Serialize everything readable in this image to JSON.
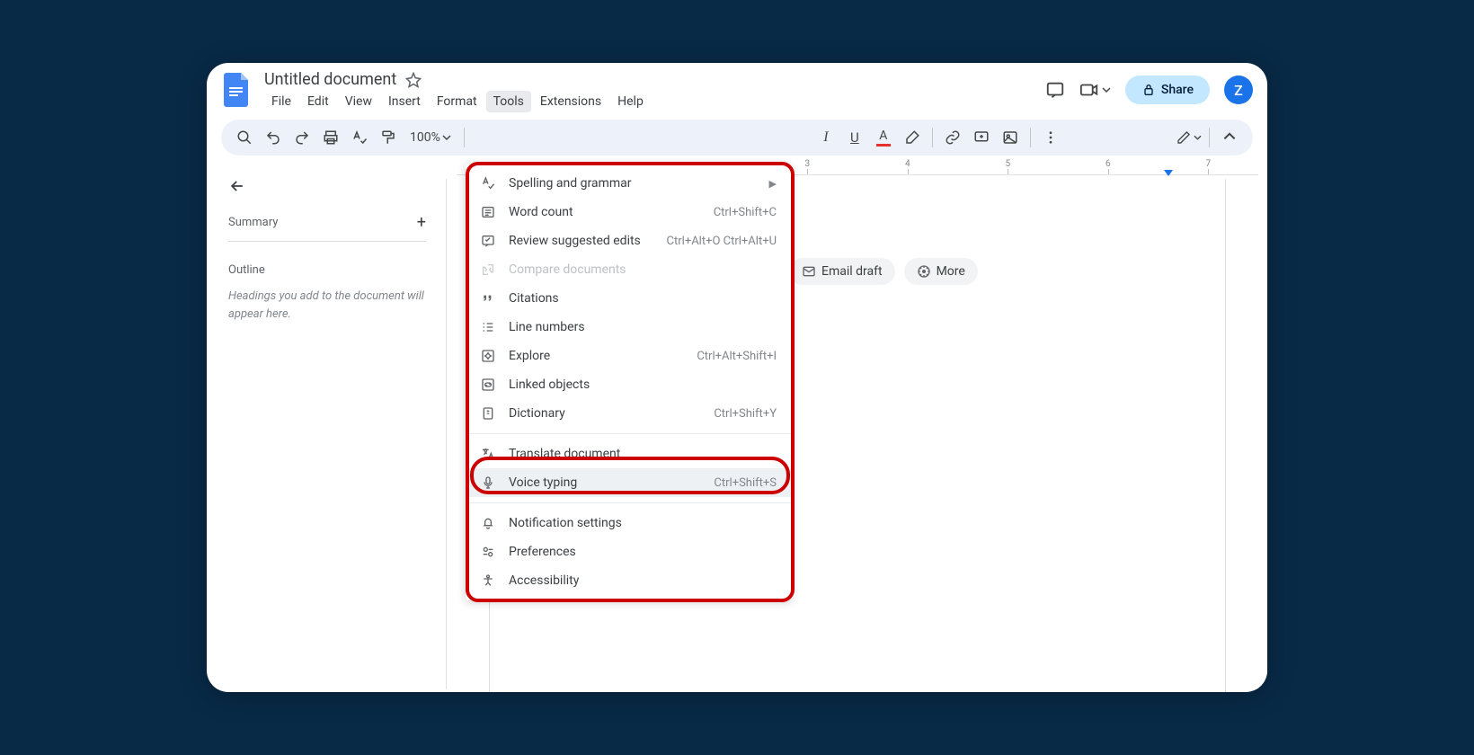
{
  "header": {
    "title": "Untitled document",
    "menus": [
      "File",
      "Edit",
      "View",
      "Insert",
      "Format",
      "Tools",
      "Extensions",
      "Help"
    ],
    "active_menu_index": 5,
    "share_label": "Share",
    "avatar_initial": "Z"
  },
  "toolbar": {
    "zoom": "100%"
  },
  "sidebar": {
    "summary_label": "Summary",
    "outline_label": "Outline",
    "outline_hint": "Headings you add to the document will appear here."
  },
  "chips": {
    "email": "Email draft",
    "more": "More"
  },
  "ruler_numbers": [
    "3",
    "4",
    "5",
    "6",
    "7"
  ],
  "tools_menu": {
    "items": [
      {
        "icon": "spellcheck",
        "label": "Spelling and grammar",
        "shortcut": "",
        "submenu": true
      },
      {
        "icon": "wordcount",
        "label": "Word count",
        "shortcut": "Ctrl+Shift+C"
      },
      {
        "icon": "review",
        "label": "Review suggested edits",
        "shortcut": "Ctrl+Alt+O Ctrl+Alt+U"
      },
      {
        "icon": "compare",
        "label": "Compare documents",
        "shortcut": "",
        "disabled": true
      },
      {
        "icon": "citations",
        "label": "Citations",
        "shortcut": ""
      },
      {
        "icon": "linenumbers",
        "label": "Line numbers",
        "shortcut": ""
      },
      {
        "icon": "explore",
        "label": "Explore",
        "shortcut": "Ctrl+Alt+Shift+I"
      },
      {
        "icon": "linked",
        "label": "Linked objects",
        "shortcut": ""
      },
      {
        "icon": "dictionary",
        "label": "Dictionary",
        "shortcut": "Ctrl+Shift+Y"
      },
      {
        "sep": true
      },
      {
        "icon": "translate",
        "label": "Translate document",
        "shortcut": ""
      },
      {
        "icon": "voice",
        "label": "Voice typing",
        "shortcut": "Ctrl+Shift+S",
        "hovered": true
      },
      {
        "sep": true
      },
      {
        "icon": "bell",
        "label": "Notification settings",
        "shortcut": ""
      },
      {
        "icon": "prefs",
        "label": "Preferences",
        "shortcut": ""
      },
      {
        "icon": "a11y",
        "label": "Accessibility",
        "shortcut": ""
      }
    ]
  }
}
